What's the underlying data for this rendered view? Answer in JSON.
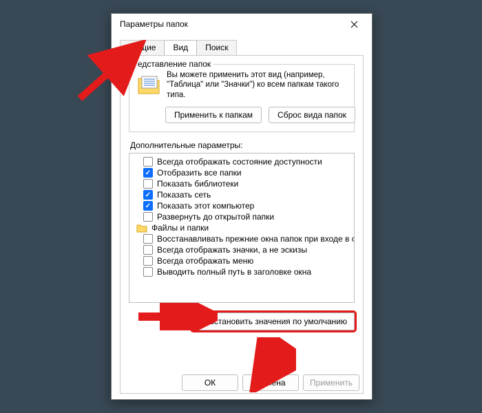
{
  "dialog": {
    "title": "Параметры папок",
    "tabs": {
      "general": "Общие",
      "view": "Вид",
      "search": "Поиск"
    },
    "folderViewGroup": {
      "legend": "едставление папок",
      "text": "Вы можете применить этот вид (например, \"Таблица\" или \"Значки\") ко всем папкам такого типа.",
      "applyButton": "Применить к папкам",
      "resetButton": "Сброс вида папок"
    },
    "advancedLabel": "Дополнительные параметры:",
    "advancedItems": [
      {
        "checked": false,
        "label": "Всегда отображать состояние доступности"
      },
      {
        "checked": true,
        "label": "Отобразить все папки"
      },
      {
        "checked": false,
        "label": "Показать библиотеки"
      },
      {
        "checked": true,
        "label": "Показать сеть"
      },
      {
        "checked": true,
        "label": "Показать этот компьютер"
      },
      {
        "checked": false,
        "label": "Развернуть до открытой папки"
      }
    ],
    "advancedGroupLabel": "Файлы и папки",
    "advancedItems2": [
      {
        "checked": false,
        "label": "Восстанавливать прежние окна папок при входе в си"
      },
      {
        "checked": false,
        "label": "Всегда отображать значки, а не эскизы"
      },
      {
        "checked": false,
        "label": "Всегда отображать меню"
      },
      {
        "checked": false,
        "label": "Выводить полный путь в заголовке окна"
      }
    ],
    "restoreDefaults": "Восстановить значения по умолчанию",
    "buttons": {
      "ok": "ОК",
      "cancel": "Отмена",
      "apply": "Применить"
    }
  }
}
